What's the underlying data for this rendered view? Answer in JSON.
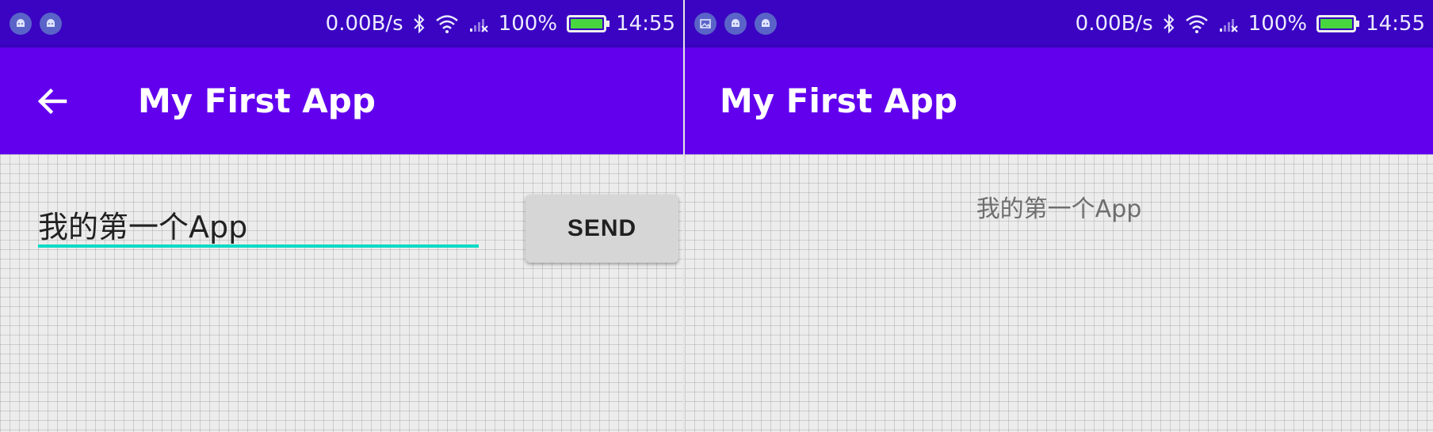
{
  "status_bar": {
    "network_speed": "0.00B/s",
    "battery_percent": "100%",
    "battery_level": 1.0,
    "time": "14:55",
    "icons": [
      "bluetooth-icon",
      "wifi-icon",
      "no-signal-icon",
      "battery-icon"
    ],
    "left_notifications": {
      "screen_left": [
        "android-icon",
        "android-icon"
      ],
      "screen_right": [
        "gallery-icon",
        "android-icon",
        "android-icon"
      ]
    }
  },
  "colors": {
    "status_bar": "#3a04c2",
    "app_bar": "#6200ee",
    "accent": "#03dac5",
    "battery_fill": "#48d63f",
    "background": "#ececec"
  },
  "main_activity": {
    "title": "My First App",
    "back_icon": "arrow-back-icon",
    "input_value": "我的第一个App",
    "send_label": "SEND"
  },
  "display_activity": {
    "title": "My First App",
    "message": "我的第一个App"
  }
}
